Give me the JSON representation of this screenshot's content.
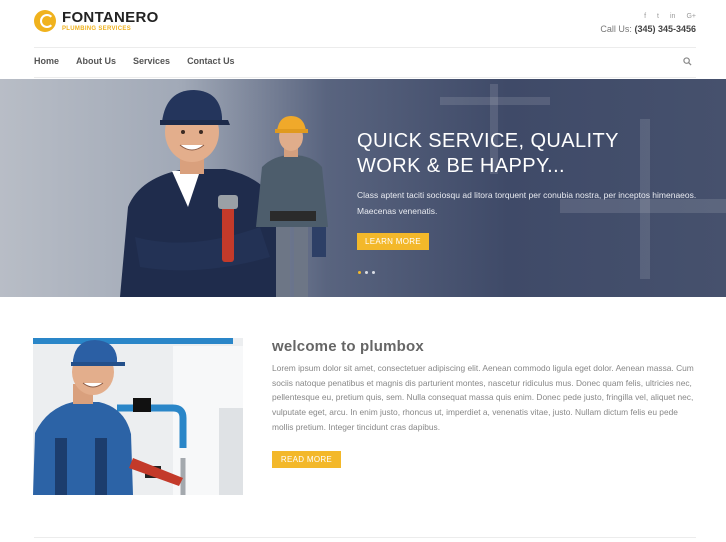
{
  "brand": {
    "name": "FONTANERO",
    "tagline": "PLUMBING SERVICES"
  },
  "header": {
    "social": [
      "f",
      "t",
      "in",
      "G+"
    ],
    "call_label": "Call Us:",
    "phone": "(345) 345-3456"
  },
  "nav": {
    "items": [
      "Home",
      "About Us",
      "Services",
      "Contact Us"
    ]
  },
  "hero": {
    "title_line1": "QUICK SERVICE, QUALITY",
    "title_line2": "WORK & BE HAPPY...",
    "text": "Class aptent taciti sociosqu ad litora torquent per conubia nostra, per inceptos himenaeos. Maecenas venenatis.",
    "button": "LEARN MORE",
    "slides": 3,
    "active_slide": 1
  },
  "welcome": {
    "title": "welcome to plumbox",
    "text": "Lorem ipsum dolor sit amet, consectetuer adipiscing elit. Aenean commodo ligula eget dolor. Aenean massa. Cum sociis natoque penatibus et magnis dis parturient montes, nascetur ridiculus mus. Donec quam felis, ultricies nec, pellentesque eu, pretium quis, sem. Nulla consequat massa quis enim. Donec pede justo, fringilla vel, aliquet nec, vulputate eget, arcu. In enim justo, rhoncus ut, imperdiet a, venenatis vitae, justo. Nullam dictum felis eu pede mollis pretium. Integer tincidunt cras dapibus.",
    "button": "READ MORE"
  },
  "colors": {
    "accent": "#f3b82a",
    "hero_dark": "#3f4a68"
  }
}
